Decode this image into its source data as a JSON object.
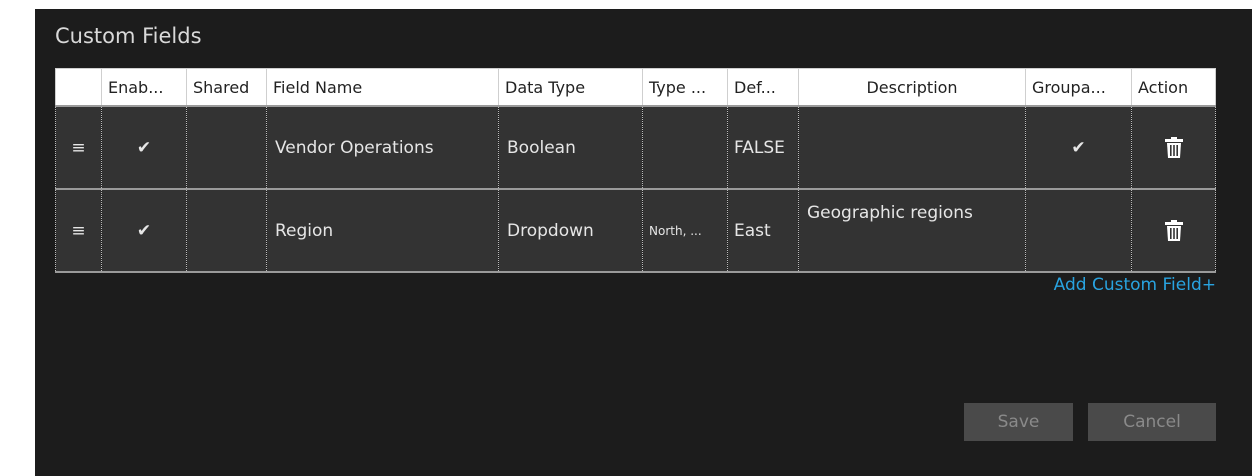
{
  "panel": {
    "title": "Custom Fields"
  },
  "table": {
    "headers": {
      "handle": "",
      "enabled": "Enab...",
      "shared": "Shared",
      "field_name": "Field Name",
      "data_type": "Data Type",
      "type_values": "Type ...",
      "default": "Def...",
      "description": "Description",
      "groupable": "Groupa...",
      "action": "Action"
    },
    "rows": [
      {
        "handle": "≡",
        "enabled": "✔",
        "shared": "",
        "field_name": "Vendor Operations",
        "data_type": "Boolean",
        "type_values": "",
        "default": "FALSE",
        "description": "",
        "groupable": "✔",
        "action_icon": "trash-icon"
      },
      {
        "handle": "≡",
        "enabled": "✔",
        "shared": "",
        "field_name": "Region",
        "data_type": "Dropdown",
        "type_values": "North, ...",
        "default": "East",
        "description": "Geographic regions",
        "groupable": "",
        "action_icon": "trash-icon"
      }
    ]
  },
  "add_custom_field_label": "Add Custom Field+",
  "buttons": {
    "save": "Save",
    "cancel": "Cancel"
  },
  "colors": {
    "panel_bg": "#1c1c1c",
    "row_bg": "#333333",
    "link": "#29a3e0",
    "button_bg": "#4a4a4a",
    "button_text": "#8a8a8a"
  }
}
